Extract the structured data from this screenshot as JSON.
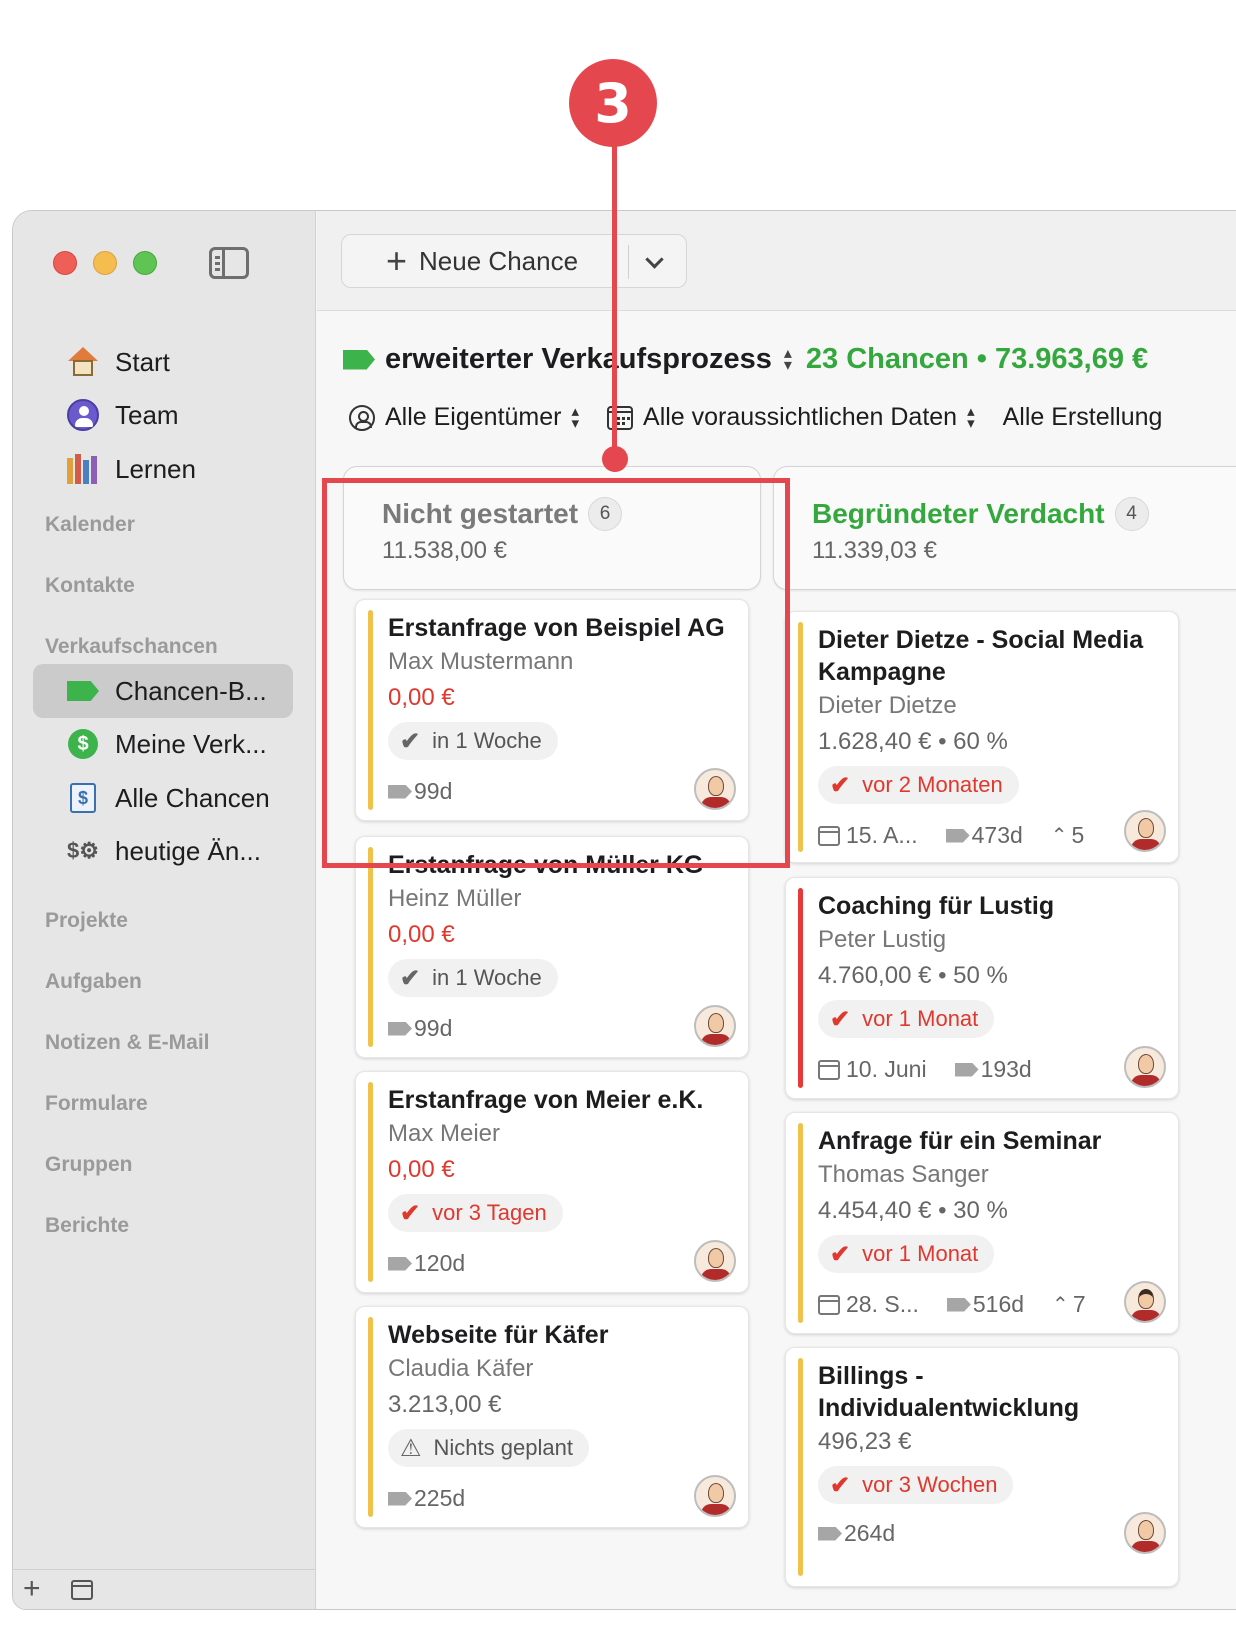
{
  "callout": {
    "number": "3"
  },
  "sidebar": {
    "primary": [
      {
        "label": "Start",
        "icon": "home-icon"
      },
      {
        "label": "Team",
        "icon": "team-icon"
      },
      {
        "label": "Lernen",
        "icon": "books-icon"
      }
    ],
    "sections": {
      "kalender": "Kalender",
      "kontakte": "Kontakte",
      "verkaufschancen": "Verkaufschancen",
      "projekte": "Projekte",
      "aufgaben": "Aufgaben",
      "notizen": "Notizen & E-Mail",
      "formulare": "Formulare",
      "gruppen": "Gruppen",
      "berichte": "Berichte"
    },
    "sales_items": [
      {
        "label": "Chancen-B...",
        "icon": "green-tag-icon",
        "active": true
      },
      {
        "label": "Meine Verk...",
        "icon": "dollar-circle-icon"
      },
      {
        "label": "Alle Chancen",
        "icon": "ledger-icon"
      },
      {
        "label": "heutige Än...",
        "icon": "dollar-gear-icon"
      }
    ]
  },
  "toolbar": {
    "new_label": "Neue Chance"
  },
  "pipeline": {
    "name": "erweiterter Verkaufsprozess",
    "stats": "23 Chancen • 73.963,69 €",
    "accent": "#34a83d"
  },
  "filters": {
    "owners": "Alle Eigentümer",
    "dates": "Alle voraussichtlichen Daten",
    "created": "Alle Erstellung"
  },
  "columns": [
    {
      "title": "Nicht gestartet",
      "count": "6",
      "sum": "11.538,00 €",
      "cards": [
        {
          "title": "Erstanfrage von Beispiel AG",
          "contact": "Max Mustermann",
          "amount": "0,00 €",
          "task": "in 1 Woche",
          "age": "99d"
        },
        {
          "title": "Erstanfrage von Müller KG",
          "contact": "Heinz Müller",
          "amount": "0,00 €",
          "task": "in 1 Woche",
          "age": "99d"
        },
        {
          "title": "Erstanfrage von Meier e.K.",
          "contact": "Max Meier",
          "amount": "0,00 €",
          "task": "vor 3 Tagen",
          "age": "120d"
        },
        {
          "title": "Webseite für Käfer",
          "contact": "Claudia Käfer",
          "amount": "3.213,00 €",
          "task": "Nichts geplant",
          "age": "225d"
        }
      ]
    },
    {
      "title": "Begründeter Verdacht",
      "count": "4",
      "sum": "11.339,03 €",
      "cards": [
        {
          "title": "Dieter Dietze - Social Media Kampagne",
          "contact": "Dieter Dietze",
          "amount": "1.628,40 € • 60 %",
          "task": "vor 2 Monaten",
          "date": "15. A...",
          "age": "473d",
          "priority": "5"
        },
        {
          "title": "Coaching für Lustig",
          "contact": "Peter Lustig",
          "amount": "4.760,00 € • 50 %",
          "task": "vor 1 Monat",
          "date": "10. Juni",
          "age": "193d"
        },
        {
          "title": "Anfrage für ein Seminar",
          "contact": "Thomas Sanger",
          "amount": "4.454,40 € • 30 %",
          "task": "vor 1 Monat",
          "date": "28. S...",
          "age": "516d",
          "priority": "7"
        },
        {
          "title": "Billings - Individualentwicklung",
          "amount": "496,23 €",
          "task": "vor 3 Wochen",
          "age": "264d"
        }
      ]
    }
  ]
}
